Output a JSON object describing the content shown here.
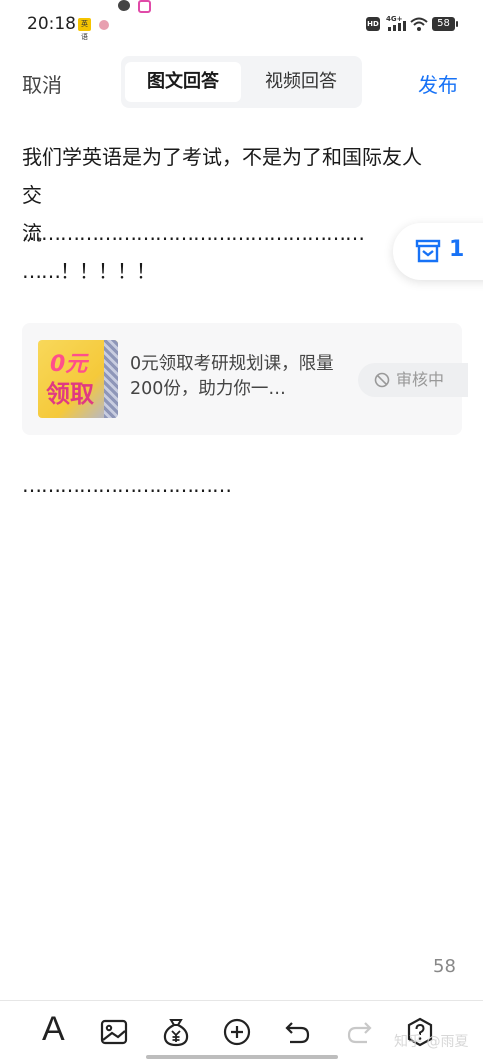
{
  "status_bar": {
    "time": "20:18",
    "app_icon_label": "英语",
    "hd": "HD",
    "network": "4G+",
    "battery": "58"
  },
  "header": {
    "cancel_label": "取消",
    "tabs": [
      {
        "label": "图文回答",
        "selected": true
      },
      {
        "label": "视频回答",
        "selected": false
      }
    ],
    "publish_label": "发布"
  },
  "content": {
    "paragraph1": "我们学英语是为了考试，不是为了和国际友人交\n流",
    "paragraph2": "………………………………………………\n……！！！！！",
    "paragraph3": "……………………………"
  },
  "draft_badge": {
    "icon": "draft-box-icon",
    "count": "1"
  },
  "card": {
    "thumb_line1": "0元",
    "thumb_line2": "领取",
    "title": "0元领取考研规划课，限量200份，助力你一…",
    "status_icon": "ban-icon",
    "status_label": "审核中"
  },
  "word_count": "58",
  "toolbar": {
    "font_label": "A",
    "icons": [
      "font-icon",
      "image-icon",
      "reward-icon",
      "add-icon",
      "undo-icon",
      "redo-icon",
      "help-icon"
    ]
  },
  "watermark": "知乎 @雨夏",
  "colors": {
    "accent": "#1772f6",
    "text": "#1a1a1a",
    "muted": "#999999"
  }
}
